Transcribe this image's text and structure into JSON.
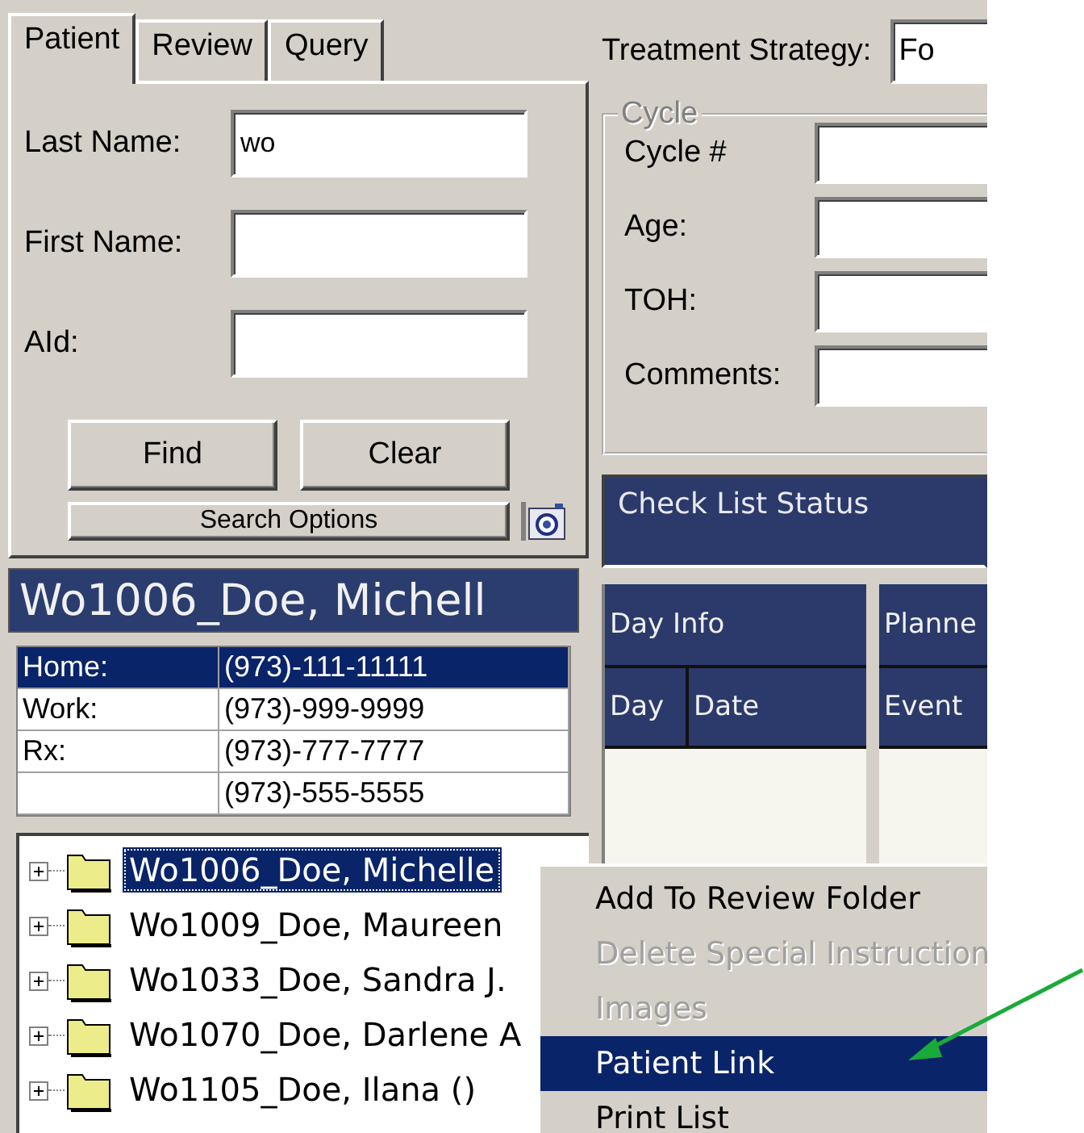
{
  "search_panel": {
    "tabs": [
      {
        "label": "Patient",
        "selected": true
      },
      {
        "label": "Review",
        "selected": false
      },
      {
        "label": "Query",
        "selected": false
      }
    ],
    "fields": [
      {
        "label": "Last Name:",
        "value": "wo"
      },
      {
        "label": "First Name:"
      },
      {
        "label": "AId:"
      }
    ],
    "buttons": [
      "Find",
      "Clear"
    ],
    "options_button": "Search Options"
  },
  "patient_header": "Wo1006_Doe, Michell",
  "phones": [
    {
      "type": "Home:",
      "number": "(973)-111-11111",
      "selected": true
    },
    {
      "type": "Work:",
      "number": "(973)-999-9999",
      "selected": false
    },
    {
      "type": "Rx:",
      "number": "(973)-777-7777",
      "selected": false
    },
    {
      "number": "(973)-555-5555",
      "selected": false
    }
  ],
  "patient_tree": [
    {
      "label": "Wo1006_Doe, Michelle",
      "selected": true,
      "expanded": false
    },
    {
      "label": "Wo1009_Doe, Maureen",
      "selected": false,
      "expanded": false
    },
    {
      "label": "Wo1033_Doe, Sandra J.",
      "selected": false,
      "expanded": false
    },
    {
      "label": "Wo1070_Doe, Darlene A",
      "selected": false,
      "expanded": false
    },
    {
      "label": "Wo1105_Doe, Ilana ()",
      "selected": false,
      "expanded": false
    }
  ],
  "treatment_strategy": {
    "label": "Treatment Strategy:",
    "value": "Fo"
  },
  "cycle": {
    "legend": "Cycle",
    "disabled": true,
    "fields": [
      {
        "label": "Cycle #"
      },
      {
        "label": "Age:"
      },
      {
        "label": "TOH:"
      },
      {
        "label": "Comments:"
      }
    ]
  },
  "check_list_status": "Check List Status",
  "schedule_grid": {
    "groups": [
      "Day Info",
      "Planne"
    ],
    "columns": [
      "Day",
      "Date",
      "Event"
    ]
  },
  "context_menu": [
    {
      "label": "Add To Review Folder",
      "disabled": false,
      "selected": false
    },
    {
      "label": "Delete Special Instruction",
      "disabled": true,
      "selected": false
    },
    {
      "label": "Images",
      "disabled": true,
      "selected": false
    },
    {
      "label": "Patient Link",
      "disabled": false,
      "selected": true
    },
    {
      "label": "Print List",
      "disabled": false,
      "selected": false
    }
  ]
}
